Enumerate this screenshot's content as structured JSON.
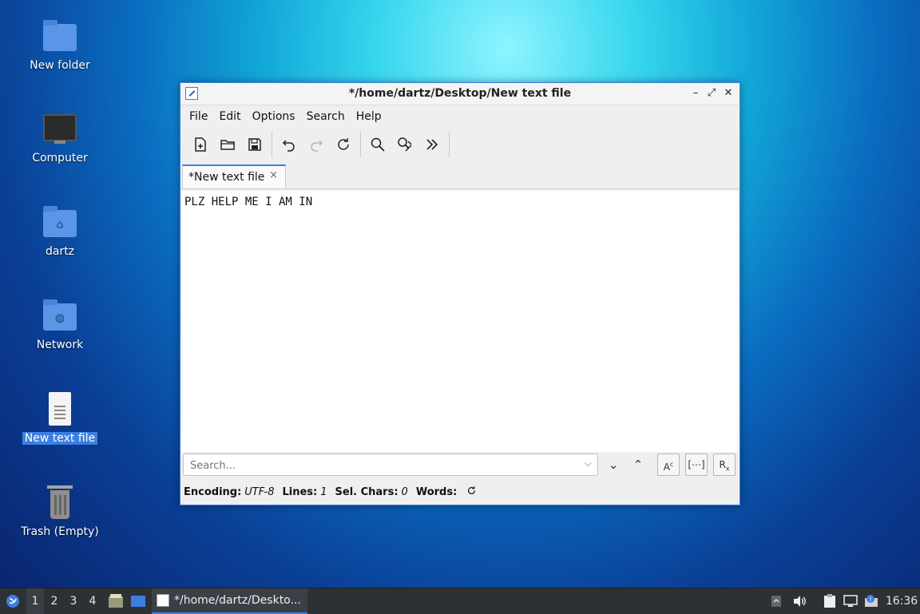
{
  "desktop": {
    "icons": [
      {
        "label": "New folder"
      },
      {
        "label": "Computer"
      },
      {
        "label": "dartz"
      },
      {
        "label": "Network"
      },
      {
        "label": "New text file"
      },
      {
        "label": "Trash (Empty)"
      }
    ]
  },
  "window": {
    "title": "*/home/dartz/Desktop/New text file",
    "controls": {
      "minimize": "–",
      "maximize": "⤢",
      "close": "✕"
    },
    "menu": [
      "File",
      "Edit",
      "Options",
      "Search",
      "Help"
    ],
    "tab": {
      "label": "*New text file",
      "close": "×"
    },
    "content": "PLZ HELP ME I AM IN",
    "search": {
      "placeholder": "Search...",
      "value": ""
    },
    "status": {
      "encoding_label": "Encoding:",
      "encoding_value": "UTF-8",
      "lines_label": "Lines:",
      "lines_value": "1",
      "selchars_label": "Sel. Chars:",
      "selchars_value": "0",
      "words_label": "Words:"
    }
  },
  "panel": {
    "workspaces": [
      "1",
      "2",
      "3",
      "4"
    ],
    "task_title": "*/home/dartz/Deskto...",
    "clock": "16:36"
  },
  "colors": {
    "accent": "#3d7fe0",
    "panel": "#2d3136"
  }
}
